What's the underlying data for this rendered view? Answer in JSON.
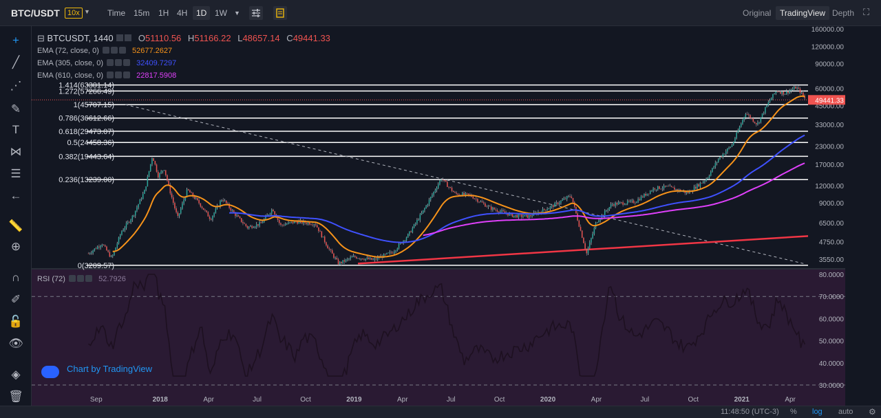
{
  "topbar": {
    "pair": "BTC/USDT",
    "leverage": "10x",
    "timeframes": [
      "Time",
      "15m",
      "1H",
      "4H",
      "1D",
      "1W"
    ],
    "active_timeframe": "1D",
    "views": [
      "Original",
      "TradingView",
      "Depth"
    ],
    "active_view": "TradingView"
  },
  "ohlc": {
    "symbol": "BTCUSDT, 1440",
    "o_label": "O",
    "o": "51110.56",
    "h_label": "H",
    "h": "51166.22",
    "l_label": "L",
    "l": "48657.14",
    "c_label": "C",
    "c": "49441.33"
  },
  "indicators": [
    {
      "label": "EMA (72, close, 0)",
      "value": "52677.2627",
      "color": "#f7931a"
    },
    {
      "label": "EMA (305, close, 0)",
      "value": "32409.7297",
      "color": "#3f51ff"
    },
    {
      "label": "EMA (610, close, 0)",
      "value": "22817.5908",
      "color": "#e040fb"
    }
  ],
  "rsi": {
    "label": "RSI (72)",
    "value": "52.7926"
  },
  "fib_levels": [
    {
      "label": "1.414(63301.14)",
      "price": 63301.14
    },
    {
      "label": "1.272(57266.49)",
      "price": 57266.49
    },
    {
      "label": "1(45707.15)",
      "price": 45707.15
    },
    {
      "label": "0.786(36612.66)",
      "price": 36612.66
    },
    {
      "label": "0.618(29473.07)",
      "price": 29473.07
    },
    {
      "label": "0.5(24458.36)",
      "price": 24458.36
    },
    {
      "label": "0.382(19443.64)",
      "price": 19443.64
    },
    {
      "label": "0.236(13239.00)",
      "price": 13239.0
    },
    {
      "label": "0(3209.57)",
      "price": 3209.57
    }
  ],
  "price_axis": [
    "160000.00",
    "120000.00",
    "90000.00",
    "60000.00",
    "45000.00",
    "33000.00",
    "23000.00",
    "17000.00",
    "12000.00",
    "9000.00",
    "6500.00",
    "4750.00",
    "3550.00"
  ],
  "price_axis_values": [
    160000,
    120000,
    90000,
    60000,
    45000,
    33000,
    23000,
    17000,
    12000,
    9000,
    6500,
    4750,
    3550
  ],
  "current_price": "49441.33",
  "rsi_axis": [
    "80.0000",
    "70.0000",
    "60.0000",
    "50.0000",
    "40.0000",
    "30.0000"
  ],
  "rsi_axis_values": [
    80,
    70,
    60,
    50,
    40,
    30
  ],
  "time_axis": [
    "Sep",
    "2018",
    "Apr",
    "Jul",
    "Oct",
    "2019",
    "Apr",
    "Jul",
    "Oct",
    "2020",
    "Apr",
    "Jul",
    "Oct",
    "2021",
    "Apr"
  ],
  "watermark": "Chart by TradingView",
  "bottom": {
    "clock": "11:48:50 (UTC-3)",
    "percent": "%",
    "log": "log",
    "auto": "auto"
  },
  "colors": {
    "background": "#131722",
    "candle_up": "#26a69a",
    "candle_down": "#ef5350",
    "trendline_red": "#f23645",
    "ema72": "#f7931a",
    "ema305": "#3f51ff",
    "ema610": "#e040fb",
    "rsi_line": "#1d1020",
    "rsi_band": "#2a1a33"
  },
  "price_series": [
    [
      2017.63,
      3900
    ],
    [
      2017.7,
      4600
    ],
    [
      2017.75,
      3600
    ],
    [
      2017.8,
      5600
    ],
    [
      2017.86,
      7300
    ],
    [
      2017.92,
      11000
    ],
    [
      2017.96,
      19700
    ],
    [
      2017.99,
      14000
    ],
    [
      2018.02,
      16000
    ],
    [
      2018.05,
      11000
    ],
    [
      2018.09,
      7000
    ],
    [
      2018.14,
      11200
    ],
    [
      2018.2,
      9000
    ],
    [
      2018.26,
      6900
    ],
    [
      2018.32,
      9700
    ],
    [
      2018.38,
      7600
    ],
    [
      2018.45,
      6000
    ],
    [
      2018.52,
      6400
    ],
    [
      2018.58,
      8200
    ],
    [
      2018.62,
      6200
    ],
    [
      2018.7,
      6600
    ],
    [
      2018.8,
      6400
    ],
    [
      2018.87,
      4200
    ],
    [
      2018.92,
      3300
    ],
    [
      2019.0,
      3700
    ],
    [
      2019.1,
      3500
    ],
    [
      2019.2,
      4000
    ],
    [
      2019.28,
      5300
    ],
    [
      2019.36,
      8000
    ],
    [
      2019.45,
      13500
    ],
    [
      2019.52,
      10500
    ],
    [
      2019.6,
      10200
    ],
    [
      2019.7,
      8300
    ],
    [
      2019.82,
      7300
    ],
    [
      2019.9,
      7200
    ],
    [
      2020.02,
      8500
    ],
    [
      2020.12,
      10200
    ],
    [
      2020.2,
      3900
    ],
    [
      2020.25,
      6600
    ],
    [
      2020.33,
      8800
    ],
    [
      2020.45,
      9200
    ],
    [
      2020.55,
      11500
    ],
    [
      2020.62,
      11700
    ],
    [
      2020.72,
      10600
    ],
    [
      2020.82,
      13500
    ],
    [
      2020.88,
      18700
    ],
    [
      2020.95,
      23500
    ],
    [
      2021.02,
      40000
    ],
    [
      2021.08,
      33000
    ],
    [
      2021.14,
      48000
    ],
    [
      2021.18,
      58000
    ],
    [
      2021.22,
      55000
    ],
    [
      2021.28,
      61000
    ],
    [
      2021.3,
      57000
    ],
    [
      2021.33,
      49441
    ]
  ]
}
